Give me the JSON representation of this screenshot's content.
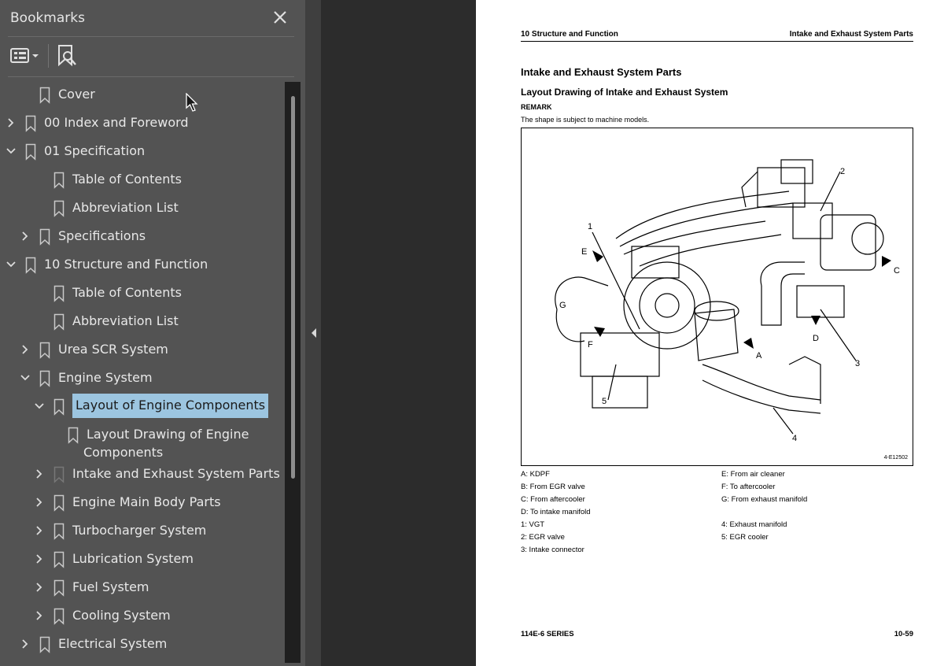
{
  "sidebar": {
    "title": "Bookmarks",
    "close_icon": "close-icon",
    "toolbar": {
      "options_icon": "bookmark-options-icon",
      "find_icon": "find-current-bookmark-icon"
    },
    "items": [
      {
        "label": "Cover",
        "level": 1,
        "expand": "none"
      },
      {
        "label": "00 Index and Foreword",
        "level": 0,
        "expand": "collapsed"
      },
      {
        "label": "01 Specification",
        "level": 0,
        "expand": "expanded"
      },
      {
        "label": "Table of Contents",
        "level": 2,
        "expand": "none"
      },
      {
        "label": "Abbreviation List",
        "level": 2,
        "expand": "none"
      },
      {
        "label": "Specifications",
        "level": 1,
        "expand": "collapsed"
      },
      {
        "label": "10 Structure and Function",
        "level": 0,
        "expand": "expanded"
      },
      {
        "label": "Table of Contents",
        "level": 2,
        "expand": "none"
      },
      {
        "label": "Abbreviation List",
        "level": 2,
        "expand": "none"
      },
      {
        "label": "Urea SCR System",
        "level": 1,
        "expand": "collapsed"
      },
      {
        "label": "Engine System",
        "level": 1,
        "expand": "expanded"
      },
      {
        "label": "Layout of Engine Components",
        "level": 2,
        "expand": "expanded",
        "selected": true
      },
      {
        "label": "Layout Drawing of Engine",
        "label2": "Components",
        "level": 3,
        "expand": "none"
      },
      {
        "label": "Intake and Exhaust System Parts",
        "level": 2,
        "expand": "collapsed"
      },
      {
        "label": "Engine Main Body Parts",
        "level": 2,
        "expand": "collapsed"
      },
      {
        "label": "Turbocharger System",
        "level": 2,
        "expand": "collapsed"
      },
      {
        "label": "Lubrication System",
        "level": 2,
        "expand": "collapsed"
      },
      {
        "label": "Fuel System",
        "level": 2,
        "expand": "collapsed"
      },
      {
        "label": "Cooling System",
        "level": 2,
        "expand": "collapsed"
      },
      {
        "label": "Electrical System",
        "level": 1,
        "expand": "collapsed"
      }
    ]
  },
  "page": {
    "header_left": "10 Structure and Function",
    "header_right": "Intake and Exhaust System Parts",
    "section_title": "Intake and Exhaust System Parts",
    "drawing_title": "Layout Drawing of Intake and Exhaust System",
    "remark_label": "REMARK",
    "remark_text": "The shape is subject to machine models.",
    "figure_id": "4-E12502",
    "figure_callouts": [
      "1",
      "2",
      "3",
      "4",
      "5",
      "A",
      "C",
      "D",
      "E",
      "F",
      "G"
    ],
    "legend_left": [
      "A: KDPF",
      "B: From EGR valve",
      "C: From aftercooler",
      "D: To intake manifold",
      "1: VGT",
      "2: EGR valve",
      "3: Intake connector"
    ],
    "legend_right": [
      "E: From air cleaner",
      "F: To aftercooler",
      "G: From exhaust manifold",
      "",
      "4: Exhaust manifold",
      "5: EGR cooler",
      ""
    ],
    "footer_left": "114E-6 SERIES",
    "footer_right": "10-59"
  },
  "colors": {
    "sidebar_bg": "#535353",
    "selection": "#9cc5e0",
    "page_bg": "#ffffff",
    "canvas_bg": "#2c2c2c"
  }
}
